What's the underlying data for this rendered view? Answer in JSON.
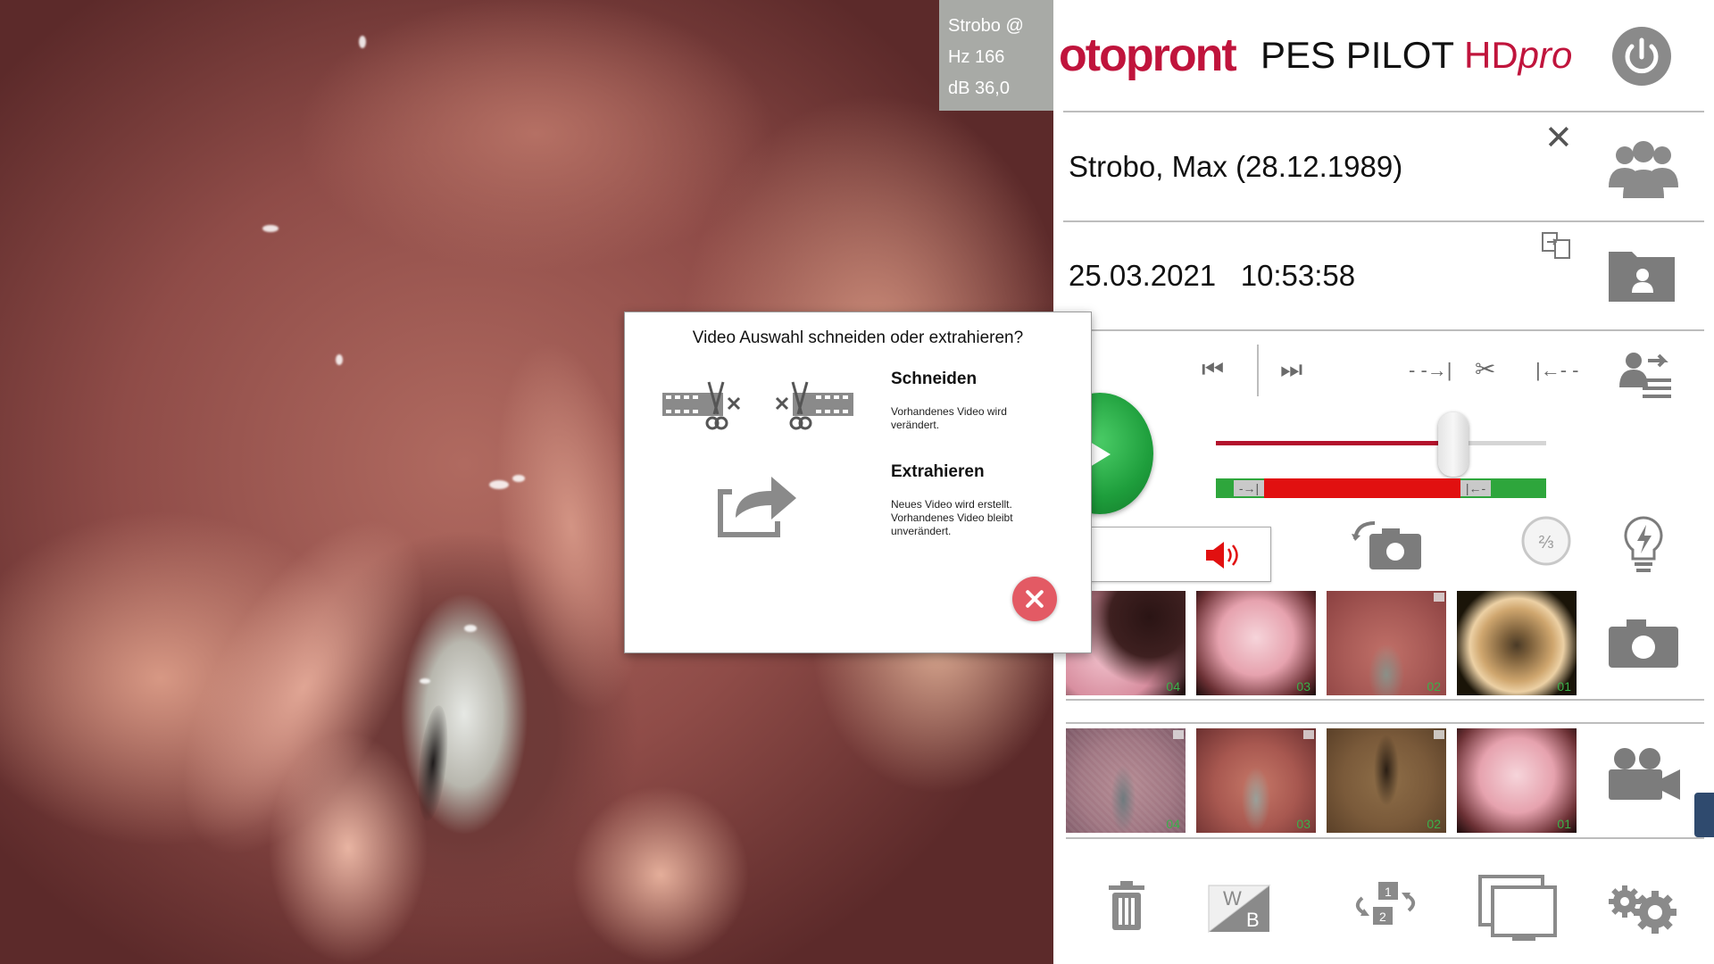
{
  "strobo": {
    "line1": "Strobo @",
    "line2": "Hz  166",
    "line3": "dB  36,0"
  },
  "header": {
    "logo": "otopront",
    "product_name": "PES PILOT",
    "product_hd": "HD",
    "product_pro": "pro"
  },
  "patient": {
    "name": "Strobo, Max (28.12.1989)"
  },
  "exam": {
    "date": "25.03.2021",
    "time": "10:53:58"
  },
  "dialog": {
    "title": "Video Auswahl schneiden oder extrahieren?",
    "cut": {
      "title": "Schneiden",
      "desc_line1": "Vorhandenes Video wird",
      "desc_line2": "verändert."
    },
    "extract": {
      "title": "Extrahieren",
      "desc_line1": "Neues Video wird erstellt.",
      "desc_line2": "Vorhandenes Video bleibt",
      "desc_line3": "unverändert."
    }
  },
  "playback": {
    "position_fraction": 0.72
  },
  "images": [
    {
      "num": "04"
    },
    {
      "num": "03"
    },
    {
      "num": "02"
    },
    {
      "num": "01"
    }
  ],
  "videos": [
    {
      "num": "04"
    },
    {
      "num": "03"
    },
    {
      "num": "02"
    },
    {
      "num": "01"
    }
  ],
  "colors": {
    "brand": "#c0143c",
    "play": "#1e9e3c",
    "range_red": "#e11010",
    "range_green": "#2ea63c",
    "close": "#e35a64"
  }
}
